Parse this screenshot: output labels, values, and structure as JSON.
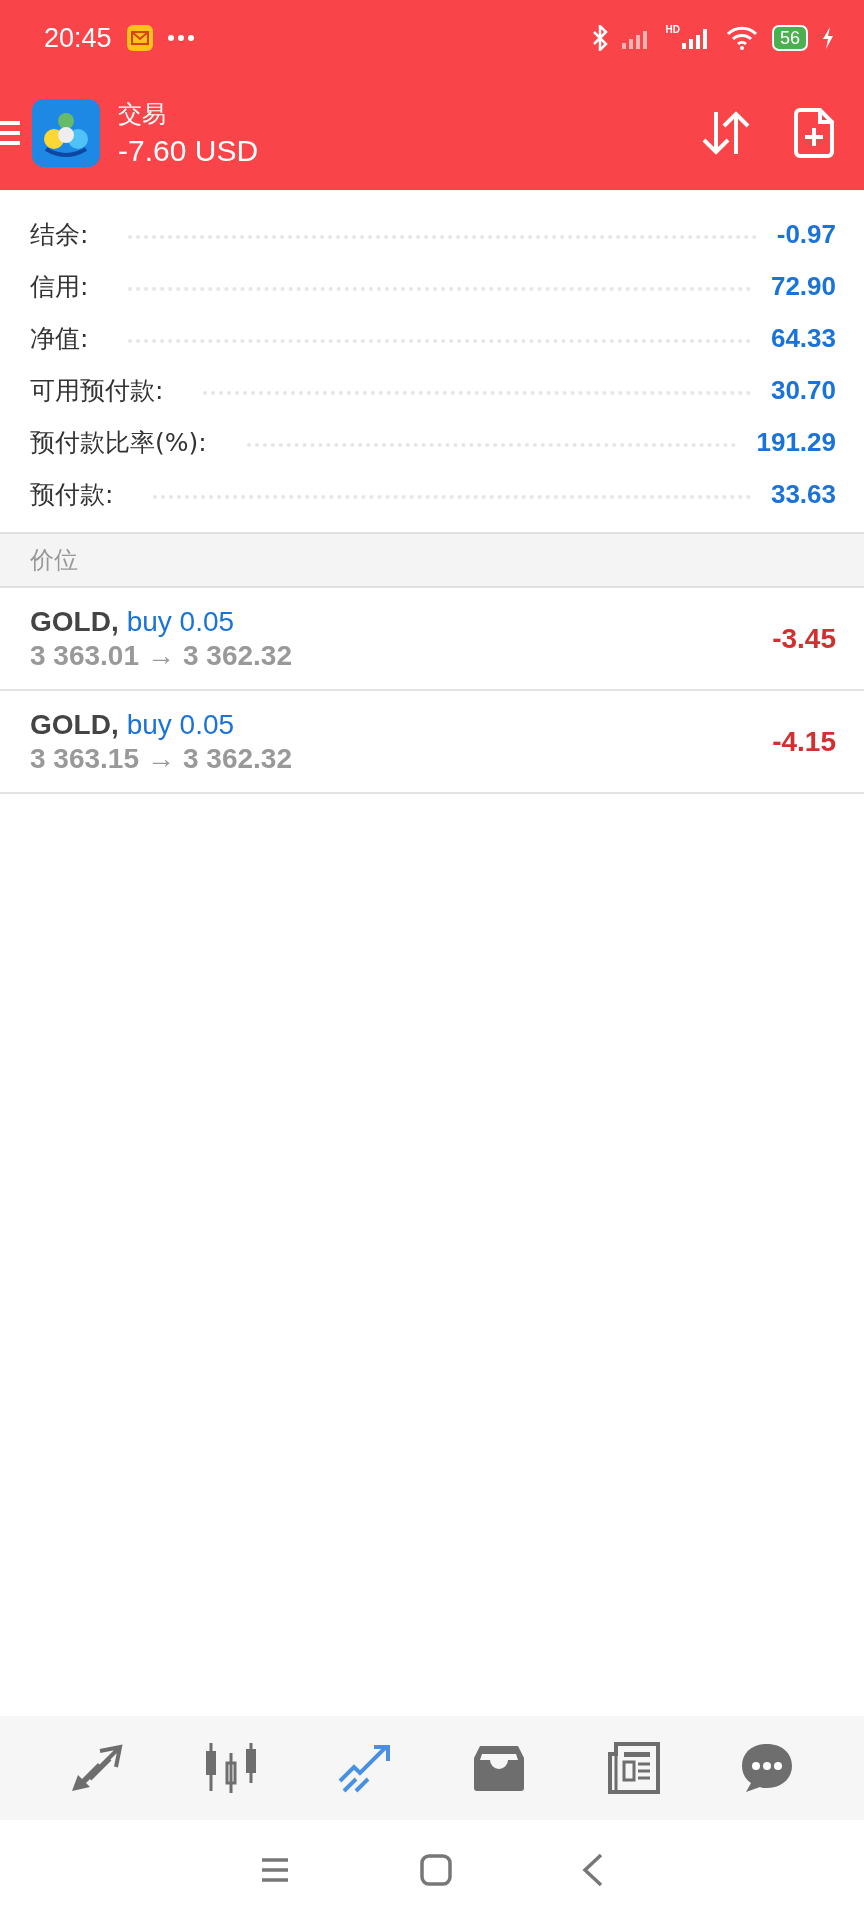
{
  "status_bar": {
    "time": "20:45",
    "network_label": "HD",
    "battery": "56"
  },
  "header": {
    "title": "交易",
    "balance": "-7.60 USD"
  },
  "summary": [
    {
      "label": "结余:",
      "value": "-0.97"
    },
    {
      "label": "信用:",
      "value": "72.90"
    },
    {
      "label": "净值:",
      "value": "64.33"
    },
    {
      "label": "可用预付款:",
      "value": "30.70"
    },
    {
      "label": "预付款比率(%):",
      "value": "191.29"
    },
    {
      "label": "预付款:",
      "value": "33.63"
    }
  ],
  "section_title": "价位",
  "positions": [
    {
      "symbol": "GOLD,",
      "side": "buy 0.05",
      "open_price": "3 363.01",
      "arrow": "→",
      "current_price": "3 362.32",
      "profit": "-3.45"
    },
    {
      "symbol": "GOLD,",
      "side": "buy 0.05",
      "open_price": "3 363.15",
      "arrow": "→",
      "current_price": "3 362.32",
      "profit": "-4.15"
    }
  ],
  "bottom_tabs": [
    {
      "kind": "quotes",
      "selected": false
    },
    {
      "kind": "chart",
      "selected": false
    },
    {
      "kind": "trade",
      "selected": true
    },
    {
      "kind": "history",
      "selected": false
    },
    {
      "kind": "news",
      "selected": false
    },
    {
      "kind": "messages",
      "selected": false
    }
  ]
}
